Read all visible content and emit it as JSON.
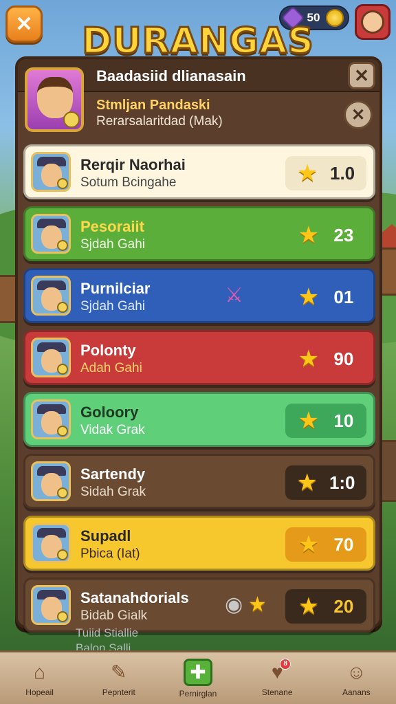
{
  "top_bar": {
    "currency_value": "50",
    "game_title": "DURANGAS"
  },
  "panel": {
    "title": "Baadasiid dlianasain",
    "player": {
      "name": "Stmljan Pandaski",
      "subtitle": "Rerarsalaritdad (Mak)"
    }
  },
  "leaderboard": [
    {
      "name": "Rerqir Naorhai",
      "subtitle": "Sotum Bcingahe",
      "score": "1.0",
      "extra_icon": ""
    },
    {
      "name": "Pesoraiit",
      "subtitle": "Sjdah Gahi",
      "score": "23",
      "extra_icon": ""
    },
    {
      "name": "Purnilciar",
      "subtitle": "Sjdah Gahi",
      "score": "01",
      "extra_icon": "sword-icon"
    },
    {
      "name": "Polonty",
      "subtitle": "Adah Gahi",
      "score": "90",
      "extra_icon": ""
    },
    {
      "name": "Goloory",
      "subtitle": "Vidak Grak",
      "score": "10",
      "extra_icon": ""
    },
    {
      "name": "Sartendy",
      "subtitle": "Sidah Grak",
      "score": "1:0",
      "extra_icon": ""
    },
    {
      "name": "Supadl",
      "subtitle": "Pbica (Iat)",
      "score": "70",
      "extra_icon": ""
    },
    {
      "name": "Satanahdorials",
      "subtitle": "Bidab Gialk",
      "score": "20",
      "extra_icon": "medal-star-icon"
    }
  ],
  "behind_text": [
    "Tuiid Stiallie",
    "Balon Salli"
  ],
  "nav": [
    {
      "label": "Hopeail",
      "icon": "home-icon"
    },
    {
      "label": "Pepnterit",
      "icon": "quest-icon",
      "badge": ""
    },
    {
      "label": "Pernirglan",
      "icon": "upgrade-icon"
    },
    {
      "label": "Stenane",
      "icon": "heart-icon",
      "badge": "8"
    },
    {
      "label": "Aanans",
      "icon": "profile-icon"
    }
  ]
}
